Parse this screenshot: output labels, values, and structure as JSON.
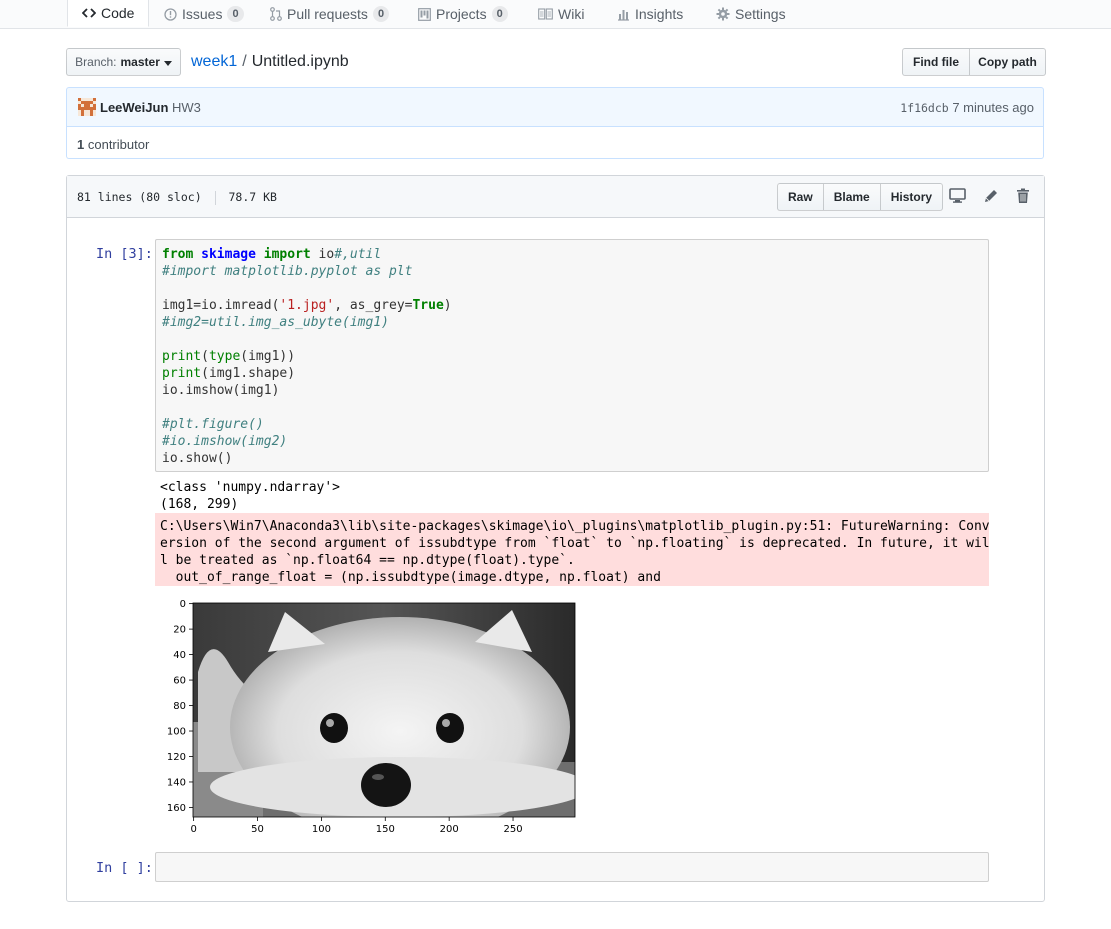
{
  "tabs": [
    {
      "label": "Code",
      "icon": "code-icon",
      "selected": true
    },
    {
      "label": "Issues",
      "icon": "issue-icon",
      "count": "0"
    },
    {
      "label": "Pull requests",
      "icon": "pull-request-icon",
      "count": "0"
    },
    {
      "label": "Projects",
      "icon": "project-icon",
      "count": "0"
    },
    {
      "label": "Wiki",
      "icon": "wiki-icon"
    },
    {
      "label": "Insights",
      "icon": "graph-icon"
    },
    {
      "label": "Settings",
      "icon": "gear-icon"
    }
  ],
  "branch": {
    "prefix": "Branch:",
    "name": "master"
  },
  "breadcrumb": {
    "repo_dir": "week1",
    "separator": "/",
    "file": "Untitled.ipynb"
  },
  "actions": {
    "find_file": "Find file",
    "copy_path": "Copy path"
  },
  "commit": {
    "author": "LeeWeiJun",
    "message": "HW3",
    "sha": "1f16dcb",
    "time": "7 minutes ago"
  },
  "contributors": {
    "count": "1",
    "label": "contributor"
  },
  "file_info": {
    "lines": "81 lines (80 sloc)",
    "size": "78.7 KB"
  },
  "file_actions": {
    "raw": "Raw",
    "blame": "Blame",
    "history": "History"
  },
  "notebook": {
    "cell1_prompt": "In [3]:",
    "cell2_prompt": "In [ ]:",
    "stdout": [
      "<class 'numpy.ndarray'>",
      "(168, 299)"
    ],
    "stderr": [
      "C:\\Users\\Win7\\Anaconda3\\lib\\site-packages\\skimage\\io\\_plugins\\matplotlib_plugin.py:51: FutureWarning: Conv",
      "ersion of the second argument of issubdtype from `float` to `np.floating` is deprecated. In future, it wil",
      "l be treated as `np.float64 == np.dtype(float).type`.",
      "  out_of_range_float = (np.issubdtype(image.dtype, np.float) and"
    ]
  },
  "chart_data": {
    "type": "image",
    "title": "",
    "xlabel": "",
    "ylabel": "",
    "x_ticks": [
      0,
      50,
      100,
      150,
      200,
      250
    ],
    "y_ticks": [
      0,
      20,
      40,
      60,
      80,
      100,
      120,
      140,
      160
    ],
    "xlim": [
      -0.5,
      298.5
    ],
    "ylim": [
      167.5,
      -0.5
    ],
    "image_shape": [
      168,
      299
    ],
    "colormap": "gray"
  }
}
